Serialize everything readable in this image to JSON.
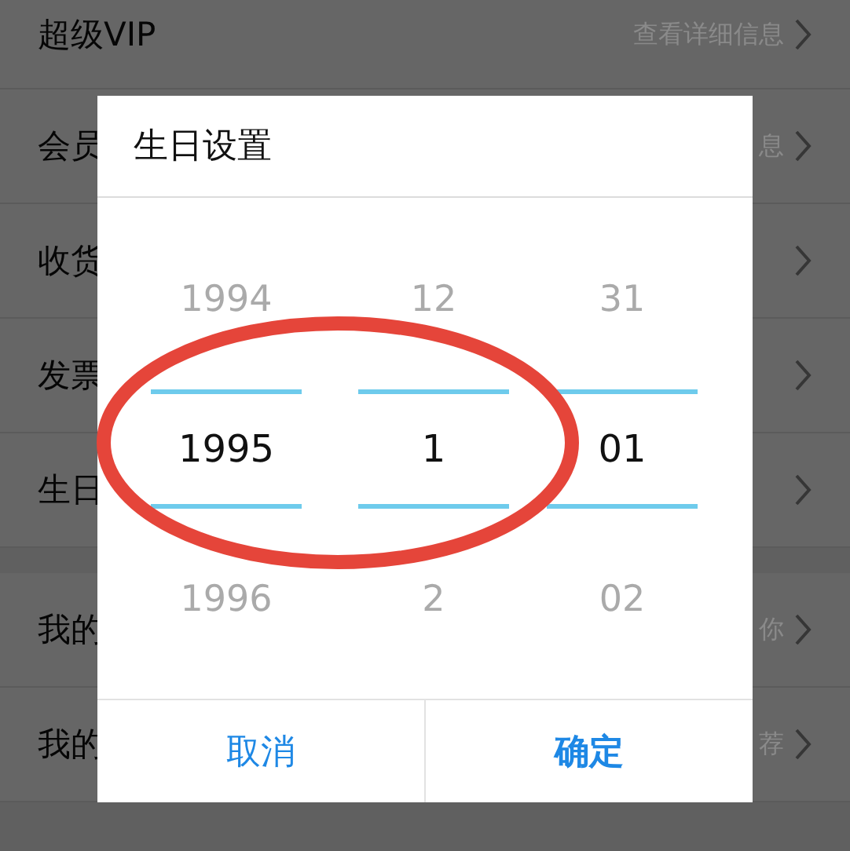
{
  "list": [
    {
      "label": "超级VIP",
      "value": "查看详细信息"
    },
    {
      "label": "会员",
      "value": "息"
    },
    {
      "label": "收货"
    },
    {
      "label": "发票"
    },
    {
      "label": "生日"
    }
  ],
  "list_2": [
    {
      "label": "我的",
      "value": "你"
    },
    {
      "label": "我的",
      "value": "荐"
    }
  ],
  "dialog": {
    "title": "生日设置",
    "picker": [
      {
        "items": [
          {
            "text": "1994",
            "selected": false
          },
          {
            "text": "1995",
            "selected": true
          },
          {
            "text": "1996",
            "selected": false
          }
        ]
      },
      {
        "items": [
          {
            "text": "12",
            "selected": false
          },
          {
            "text": "1",
            "selected": true
          },
          {
            "text": "2",
            "selected": false
          }
        ]
      },
      {
        "items": [
          {
            "text": "31",
            "selected": false
          },
          {
            "text": "01",
            "selected": true
          },
          {
            "text": "02",
            "selected": false
          }
        ]
      }
    ],
    "buttons": [
      {
        "label": "取消",
        "kind": "cancel"
      },
      {
        "label": "确定",
        "kind": "confirm"
      }
    ]
  },
  "annotation": {
    "kind": "ellipse"
  }
}
